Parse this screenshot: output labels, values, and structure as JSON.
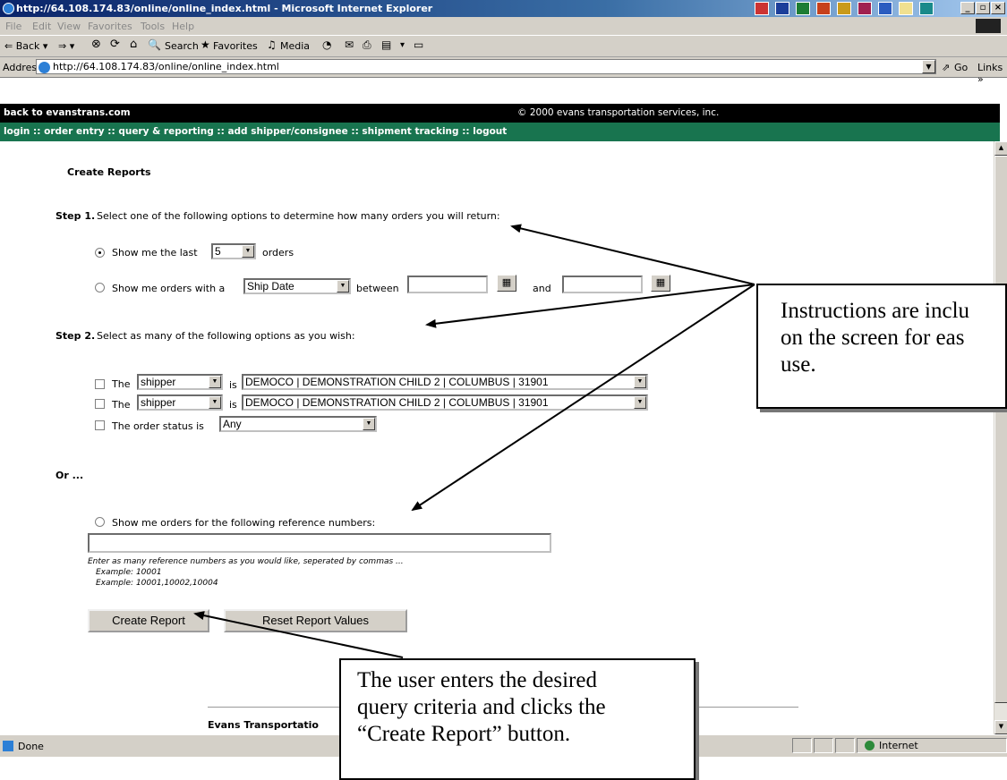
{
  "browser": {
    "title": "http://64.108.174.83/online/online_index.html - Microsoft Internet Explorer",
    "menu": [
      "File",
      "Edit",
      "View",
      "Favorites",
      "Tools",
      "Help"
    ],
    "toolbar": {
      "back": "⇐ Back ▾",
      "forward": "⇒ ▾",
      "search": "Search",
      "favorites": "Favorites",
      "media": "Media"
    },
    "address_label": "Address",
    "address": "http://64.108.174.83/online/online_index.html",
    "go": "Go",
    "links": "Links »",
    "status_text": "Done",
    "zone": "Internet"
  },
  "site": {
    "back_link": "back to evanstrans.com",
    "copyright": "© 2000 evans transportation services, inc.",
    "nav": "login :: order entry :: query & reporting :: add shipper/consignee :: shipment tracking :: logout"
  },
  "form": {
    "heading": "Create Reports",
    "step1_label": "Step 1.",
    "step1_text": "Select one of the following options to determine how many orders you will return:",
    "opt1_prefix": "Show me the last",
    "opt1_count": "5",
    "opt1_suffix": "orders",
    "opt2_prefix": "Show me orders with a",
    "opt2_field": "Ship Date",
    "opt2_between": "between",
    "opt2_and": "and",
    "step2_label": "Step 2.",
    "step2_text": "Select as many of the following options as you wish:",
    "row1_the": "The",
    "row1_field": "shipper",
    "row1_is": "is",
    "row1_value": "DEMOCO | DEMONSTRATION CHILD 2 | COLUMBUS | 31901",
    "row2_the": "The",
    "row2_field": "shipper",
    "row2_is": "is",
    "row2_value": "DEMOCO | DEMONSTRATION CHILD 2 | COLUMBUS | 31901",
    "row3_text": "The order status is",
    "row3_value": "Any",
    "or": "Or ...",
    "ref_label": "Show me orders for the following reference numbers:",
    "ref_help": "Enter as many reference numbers as you would like, seperated by commas ...",
    "ref_ex1": "Example: 10001",
    "ref_ex2": "Example: 10001,10002,10004",
    "create_btn": "Create Report",
    "reset_btn": "Reset Report Values",
    "footer": "Evans Transportatio"
  },
  "callouts": {
    "top_line1": "Instructions are inclu",
    "top_line2": "on the screen for eas",
    "top_line3": "use.",
    "bottom_line1": "The user enters the desired",
    "bottom_line2": "query criteria and clicks the",
    "bottom_line3": "“Create Report” button."
  }
}
